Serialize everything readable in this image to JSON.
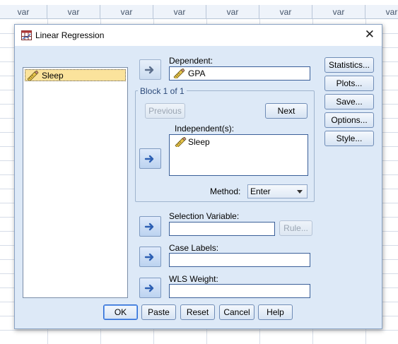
{
  "sheet": {
    "column_label": "var"
  },
  "dialog": {
    "title": "Linear Regression",
    "close_glyph": "✕"
  },
  "variables": [
    {
      "name": "Sleep"
    }
  ],
  "dependent": {
    "label": "Dependent:",
    "value": "GPA"
  },
  "block": {
    "title": "Block 1 of 1",
    "previous_label": "Previous",
    "next_label": "Next",
    "independents_label": "Independent(s):",
    "independents": [
      "Sleep"
    ],
    "method_label": "Method:",
    "method_value": "Enter"
  },
  "selection": {
    "label": "Selection Variable:",
    "value": "",
    "rule_label": "Rule..."
  },
  "case_labels": {
    "label": "Case Labels:",
    "value": ""
  },
  "wls": {
    "label": "WLS Weight:",
    "value": ""
  },
  "side_buttons": [
    "Statistics...",
    "Plots...",
    "Save...",
    "Options...",
    "Style..."
  ],
  "bottom_buttons": {
    "ok": "OK",
    "paste": "Paste",
    "reset": "Reset",
    "cancel": "Cancel",
    "help": "Help"
  },
  "icons": {
    "app": "linear-regression-app-icon",
    "scale_variable": "ruler-pencil-icon",
    "move": "arrow-right-icon"
  },
  "colors": {
    "dialog_bg": "#dde9f7",
    "selected_item": "#fbe39c",
    "accent_border": "#3a5f99"
  }
}
